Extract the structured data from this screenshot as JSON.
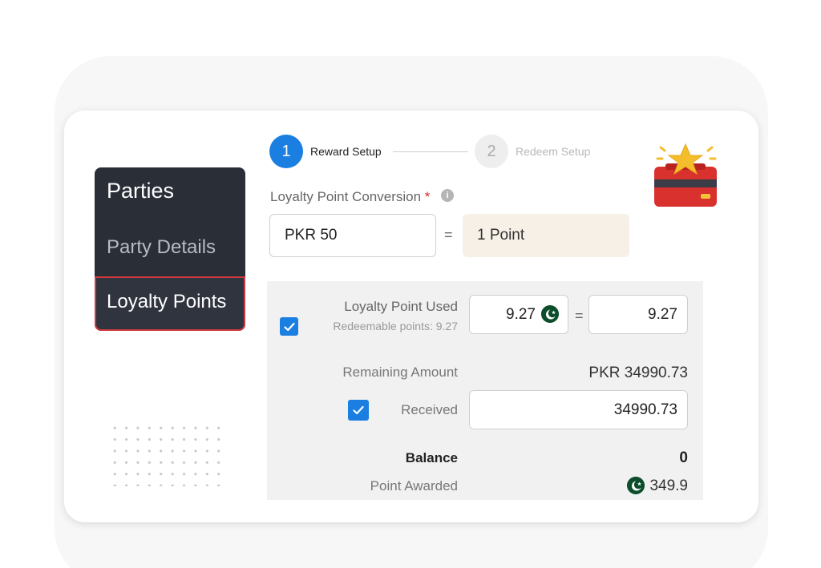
{
  "sidebar": {
    "title": "Parties",
    "items": [
      {
        "label": "Party Details"
      },
      {
        "label": "Loyalty Points"
      }
    ]
  },
  "stepper": {
    "steps": [
      {
        "number": "1",
        "label": "Reward Setup",
        "state": "active"
      },
      {
        "number": "2",
        "label": "Redeem Setup",
        "state": "inactive"
      }
    ]
  },
  "conversion": {
    "label": "Loyalty Point Conversion",
    "required_mark": "*",
    "info_icon": "info-icon",
    "amount_value": "PKR 50",
    "equals": "=",
    "points_value": "1 Point"
  },
  "redeem": {
    "loyalty_used_label": "Loyalty Point Used",
    "redeemable_text": "Redeemable points: 9.27",
    "loyalty_used_checked": true,
    "points_value": "9.27",
    "equals": "=",
    "amount_value": "9.27",
    "remaining_label": "Remaining Amount",
    "remaining_value": "PKR 34990.73",
    "received_label": "Received",
    "received_checked": true,
    "received_value": "34990.73",
    "balance_label": "Balance",
    "balance_value": "0",
    "awarded_label": "Point Awarded",
    "awarded_value": "349.9"
  },
  "colors": {
    "accent": "#1a7fe0",
    "sidebar_bg": "#2a2e37",
    "active_border": "#d0393f",
    "points_bg": "#f6f0e6",
    "flag_green": "#0c4e2c"
  }
}
